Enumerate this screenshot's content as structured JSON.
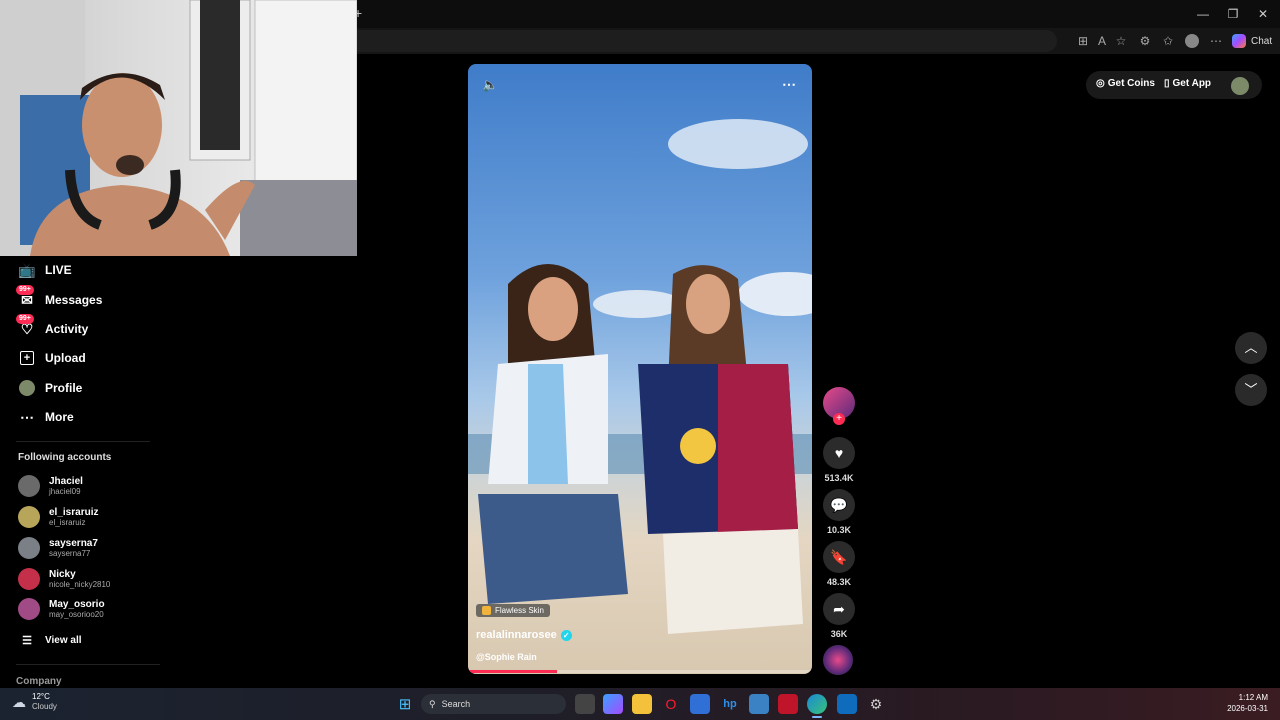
{
  "browser": {
    "new_tab": "+",
    "window_controls": {
      "minimize": "—",
      "restore": "❐",
      "close": "✕"
    },
    "toolbar_icons": [
      "grid-icon",
      "read-aloud-icon",
      "favorite-star-icon",
      "extensions-icon",
      "favorites-icon",
      "profile-icon",
      "more-icon"
    ],
    "copilot_label": "Chat"
  },
  "header": {
    "get_coins": "Get Coins",
    "get_app": "Get App"
  },
  "sidebar": {
    "items": [
      {
        "label": "LIVE",
        "icon": "live-tv-icon"
      },
      {
        "label": "Messages",
        "icon": "messages-icon",
        "badge": "99+"
      },
      {
        "label": "Activity",
        "icon": "activity-icon",
        "badge": "99+"
      },
      {
        "label": "Upload",
        "icon": "upload-icon"
      },
      {
        "label": "Profile",
        "icon": "profile-icon"
      },
      {
        "label": "More",
        "icon": "more-dots-icon"
      }
    ],
    "following_title": "Following accounts",
    "accounts": [
      {
        "name": "Jhaciel",
        "handle": "jhaciel09",
        "color": "#6a6a6a"
      },
      {
        "name": "el_israruiz",
        "handle": "el_israruiz",
        "color": "#b7a55a"
      },
      {
        "name": "sayserna7",
        "handle": "sayserna77",
        "color": "#7b7f86"
      },
      {
        "name": "Nicky",
        "handle": "nicole_nicky2810",
        "color": "#c42f4a"
      },
      {
        "name": "May_osorio",
        "handle": "may_osorioo20",
        "color": "#a04a86"
      }
    ],
    "view_all": "View all",
    "company": "Company"
  },
  "video": {
    "tag": "Flawless Skin",
    "username": "realalinnaroseе",
    "mention": "@Sophie Rain",
    "progress": 0.26
  },
  "actions": {
    "likes": "513.4K",
    "comments": "10.3K",
    "saves": "48.3K",
    "shares": "36K"
  },
  "taskbar": {
    "weather_temp": "12°C",
    "weather_desc": "Cloudy",
    "search": "Search",
    "time": "1:12 AM",
    "date": "2026-03-31"
  },
  "colors": {
    "accent": "#fe2c55",
    "verified": "#20d5ec"
  }
}
